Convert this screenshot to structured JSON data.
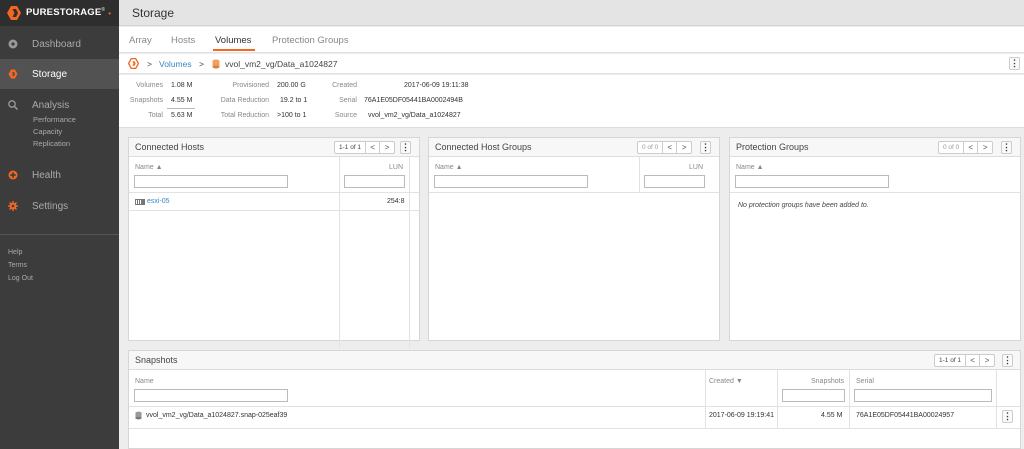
{
  "brand": {
    "name": "PURESTORAGE",
    "tm": "®"
  },
  "nav": {
    "items": [
      {
        "label": "Dashboard",
        "icon": "dashboard-icon"
      },
      {
        "label": "Storage",
        "icon": "storage-icon"
      },
      {
        "label": "Analysis",
        "icon": "analysis-icon"
      },
      {
        "label": "Health",
        "icon": "health-icon"
      },
      {
        "label": "Settings",
        "icon": "settings-icon"
      }
    ],
    "analysis_sub": [
      "Performance",
      "Capacity",
      "Replication"
    ],
    "footer": [
      "Help",
      "Terms",
      "Log Out"
    ]
  },
  "header": {
    "title": "Storage"
  },
  "tabs": [
    "Array",
    "Hosts",
    "Volumes",
    "Protection Groups"
  ],
  "breadcrumb": {
    "sep": ">",
    "volumes": "Volumes",
    "current": "vvol_vm2_vg/Data_a1024827"
  },
  "stats": {
    "volumes_k": "Volumes",
    "volumes_v": "1.08 M",
    "snapshots_k": "Snapshots",
    "snapshots_v": "4.55 M",
    "total_k": "Total",
    "total_v": "5.63 M",
    "provisioned_k": "Provisioned",
    "provisioned_v": "200.00 G",
    "reduction_k": "Data Reduction",
    "reduction_v": "19.2 to 1",
    "treduction_k": "Total Reduction",
    "treduction_v": ">100 to 1",
    "created_k": "Created",
    "created_v": "2017-06-09 19:11:38",
    "serial_k": "Serial",
    "serial_v": "76A1E05DF05441BA0002494B",
    "source_k": "Source",
    "source_v": "vvol_vm2_vg/Data_a1024827"
  },
  "connected_hosts": {
    "title": "Connected Hosts",
    "pager": "1-1 of 1",
    "col_name": "Name ▲",
    "col_lun": "LUN",
    "rows": [
      {
        "name": "esxi-05",
        "lun": "254:8"
      }
    ]
  },
  "connected_host_groups": {
    "title": "Connected Host Groups",
    "pager": "0 of 0",
    "col_name": "Name ▲",
    "col_lun": "LUN"
  },
  "protection_groups": {
    "title": "Protection Groups",
    "pager": "0 of 0",
    "col_name": "Name ▲",
    "empty": "No protection groups have been added to."
  },
  "snapshots": {
    "title": "Snapshots",
    "pager": "1-1 of 1",
    "col_name": "Name",
    "col_created": "Created ▼",
    "col_snapshots": "Snapshots",
    "col_serial": "Serial",
    "rows": [
      {
        "name": "vvol_vm2_vg/Data_a1024827.snap-025eaf39",
        "created": "2017-06-09 19:19:41",
        "snapshots": "4.55 M",
        "serial": "76A1E05DF05441BA00024957"
      }
    ]
  },
  "glyphs": {
    "prev": "<",
    "next": ">",
    "kebab": "⋮"
  },
  "colors": {
    "accent": "#f26722",
    "link": "#3b86c6",
    "sidebar": "#3c3c3c"
  }
}
